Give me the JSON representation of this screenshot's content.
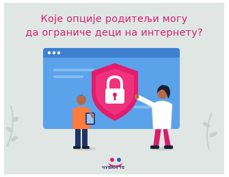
{
  "header": {
    "line1": "Које опције родитељи могу",
    "line2": "да ограниче деци на интернету?"
  },
  "logo": {
    "text": "ЧУВАМ ТЕ"
  },
  "colors": {
    "accent": "#d51f6b",
    "background": "#dfe6e4",
    "screen": "#4d96e2",
    "window_bar": "#3a72c2"
  },
  "icons": {
    "shield": "padlock-shield-icon",
    "logo": "heart-people-logo-icon"
  }
}
